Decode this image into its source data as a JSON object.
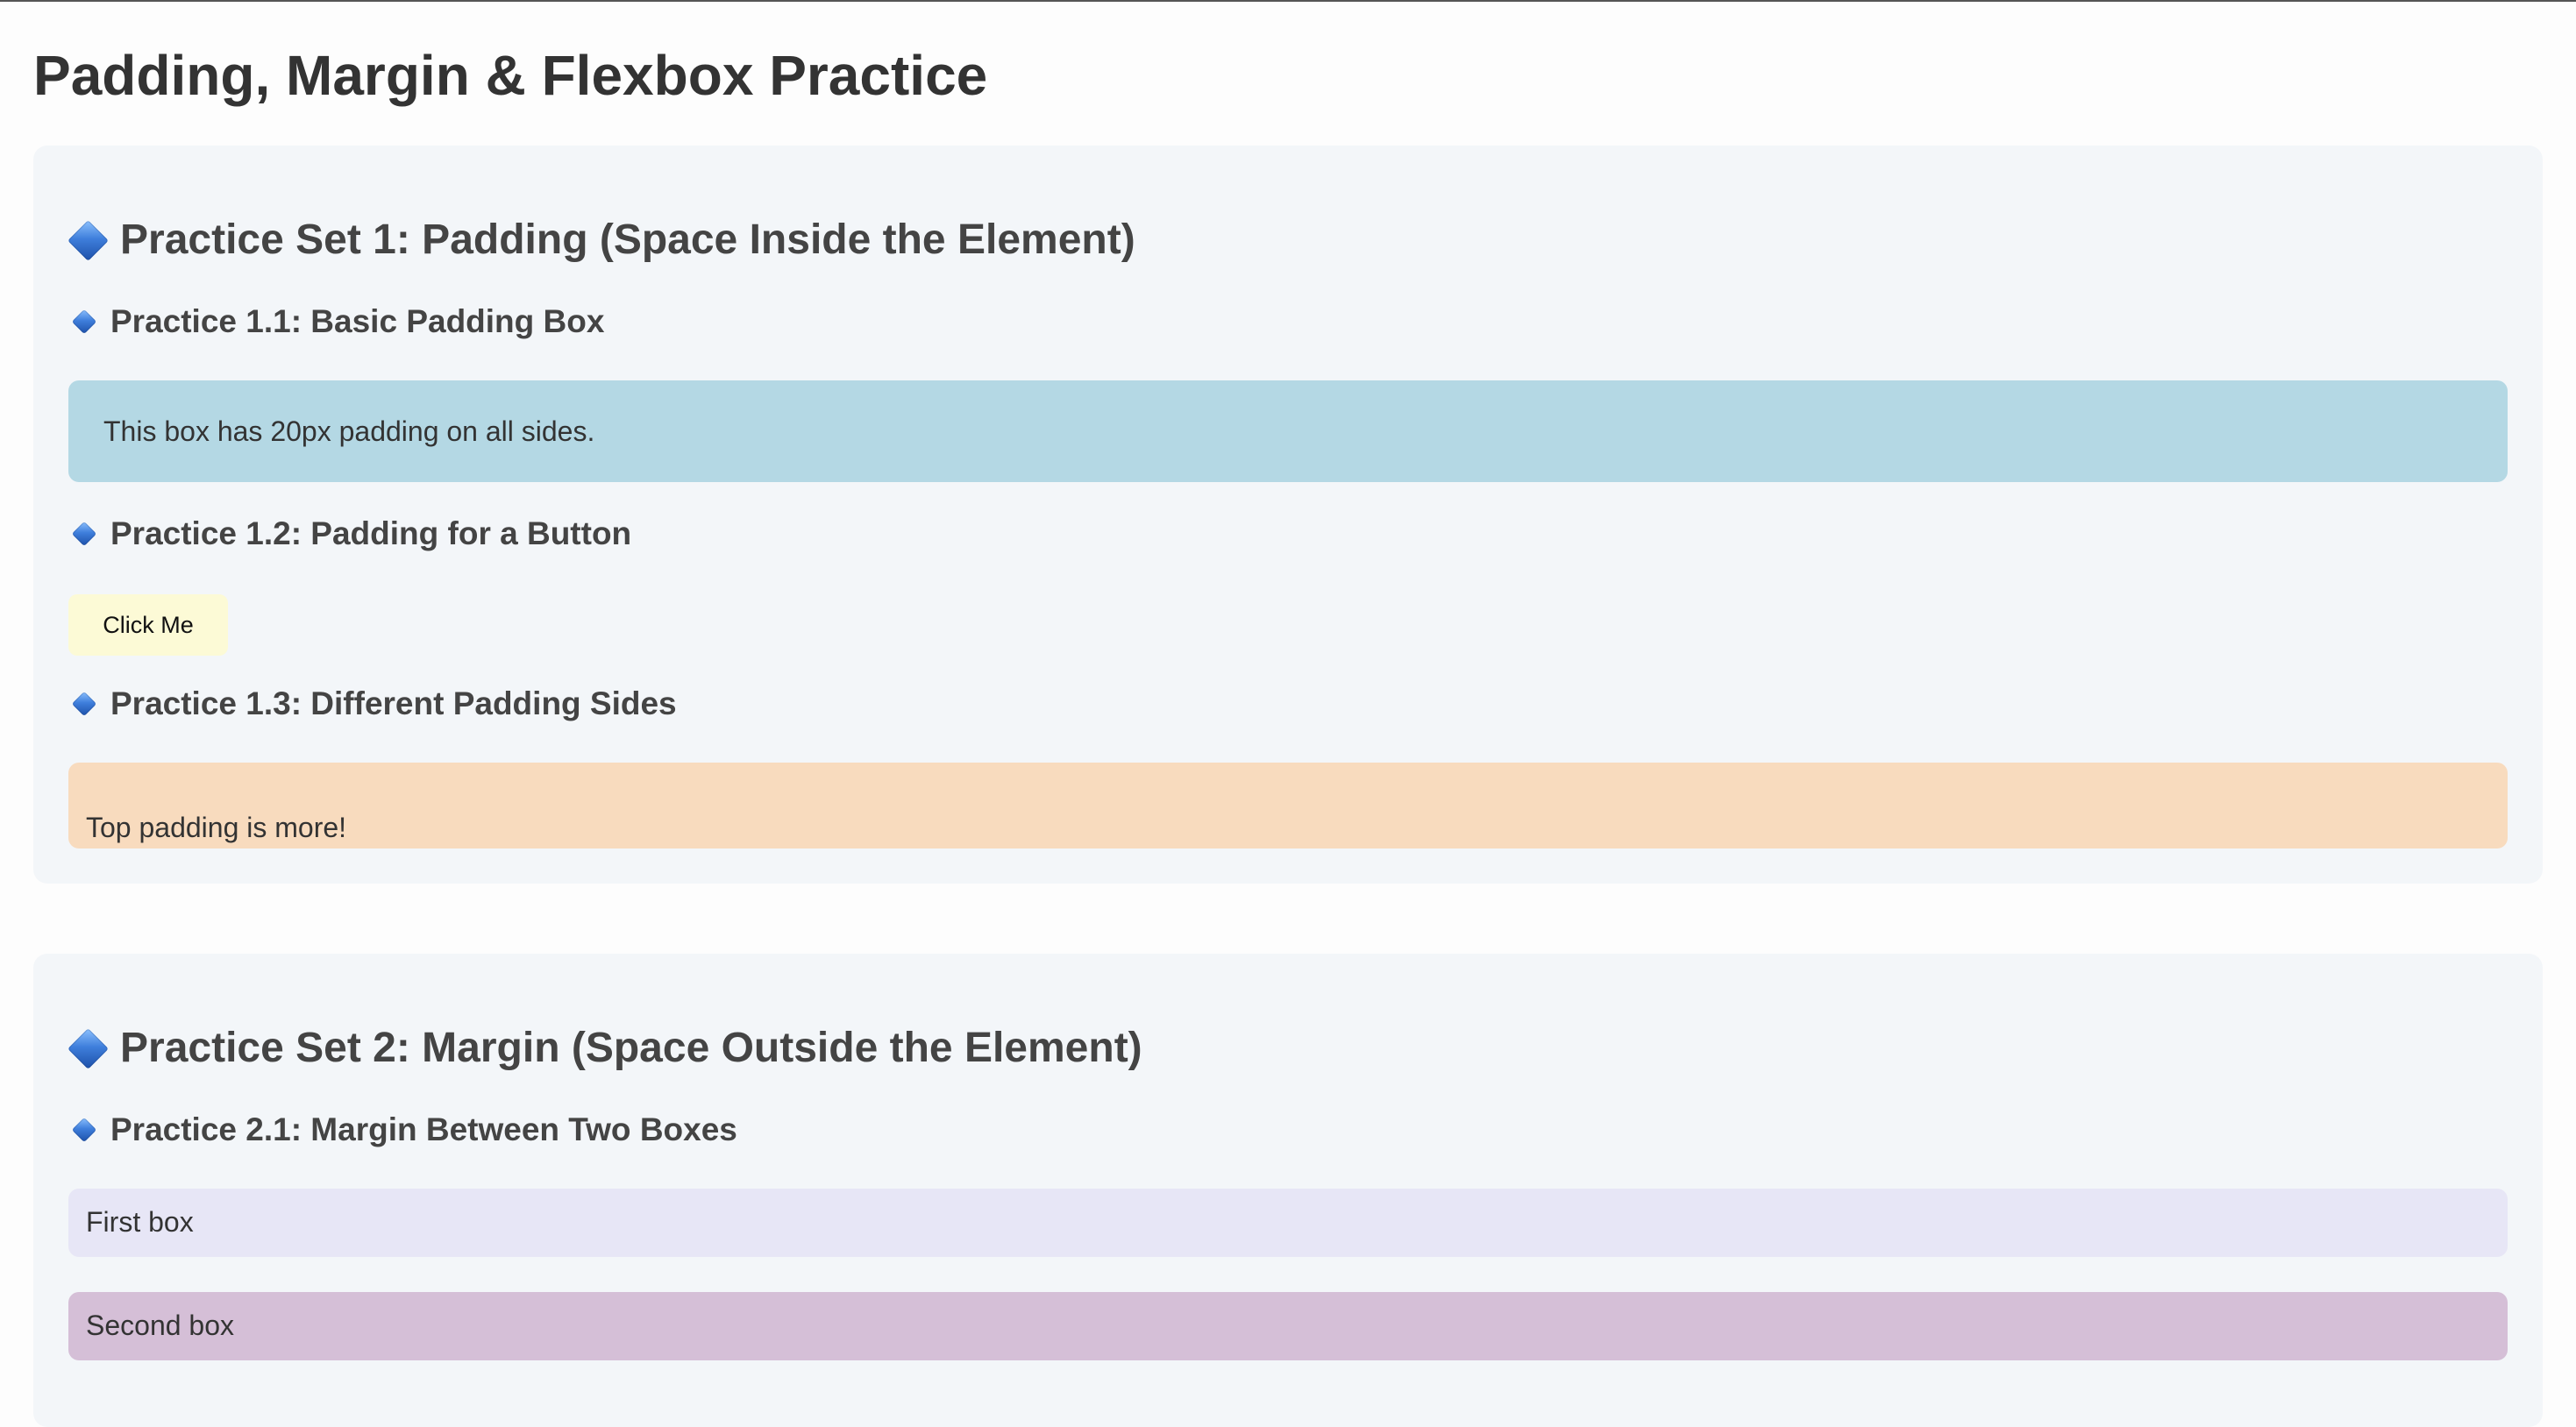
{
  "page": {
    "title": "Padding, Margin & Flexbox Practice"
  },
  "section1": {
    "heading": "Practice Set 1: Padding (Space Inside the Element)",
    "practice_1_1": {
      "heading": "Practice 1.1: Basic Padding Box",
      "box_text": "This box has 20px padding on all sides."
    },
    "practice_1_2": {
      "heading": "Practice 1.2: Padding for a Button",
      "button_label": "Click Me"
    },
    "practice_1_3": {
      "heading": "Practice 1.3: Different Padding Sides",
      "box_text": "Top padding is more!"
    }
  },
  "section2": {
    "heading": "Practice Set 2: Margin (Space Outside the Element)",
    "practice_2_1": {
      "heading": "Practice 2.1: Margin Between Two Boxes",
      "first_box_text": "First box",
      "second_box_text": "Second box"
    }
  },
  "icons": {
    "section_marker": "blue-diamond-icon",
    "sub_marker": "small-blue-diamond-icon"
  },
  "colors": {
    "section_bg": "#f3f6f9",
    "padding_box_bg": "#b4d8e4",
    "button_bg": "#fcfad6",
    "orange_box_bg": "#f8dbbe",
    "first_box_bg": "#e7e6f6",
    "second_box_bg": "#d5bfd7",
    "diamond_blue": "#3f7fdc"
  }
}
